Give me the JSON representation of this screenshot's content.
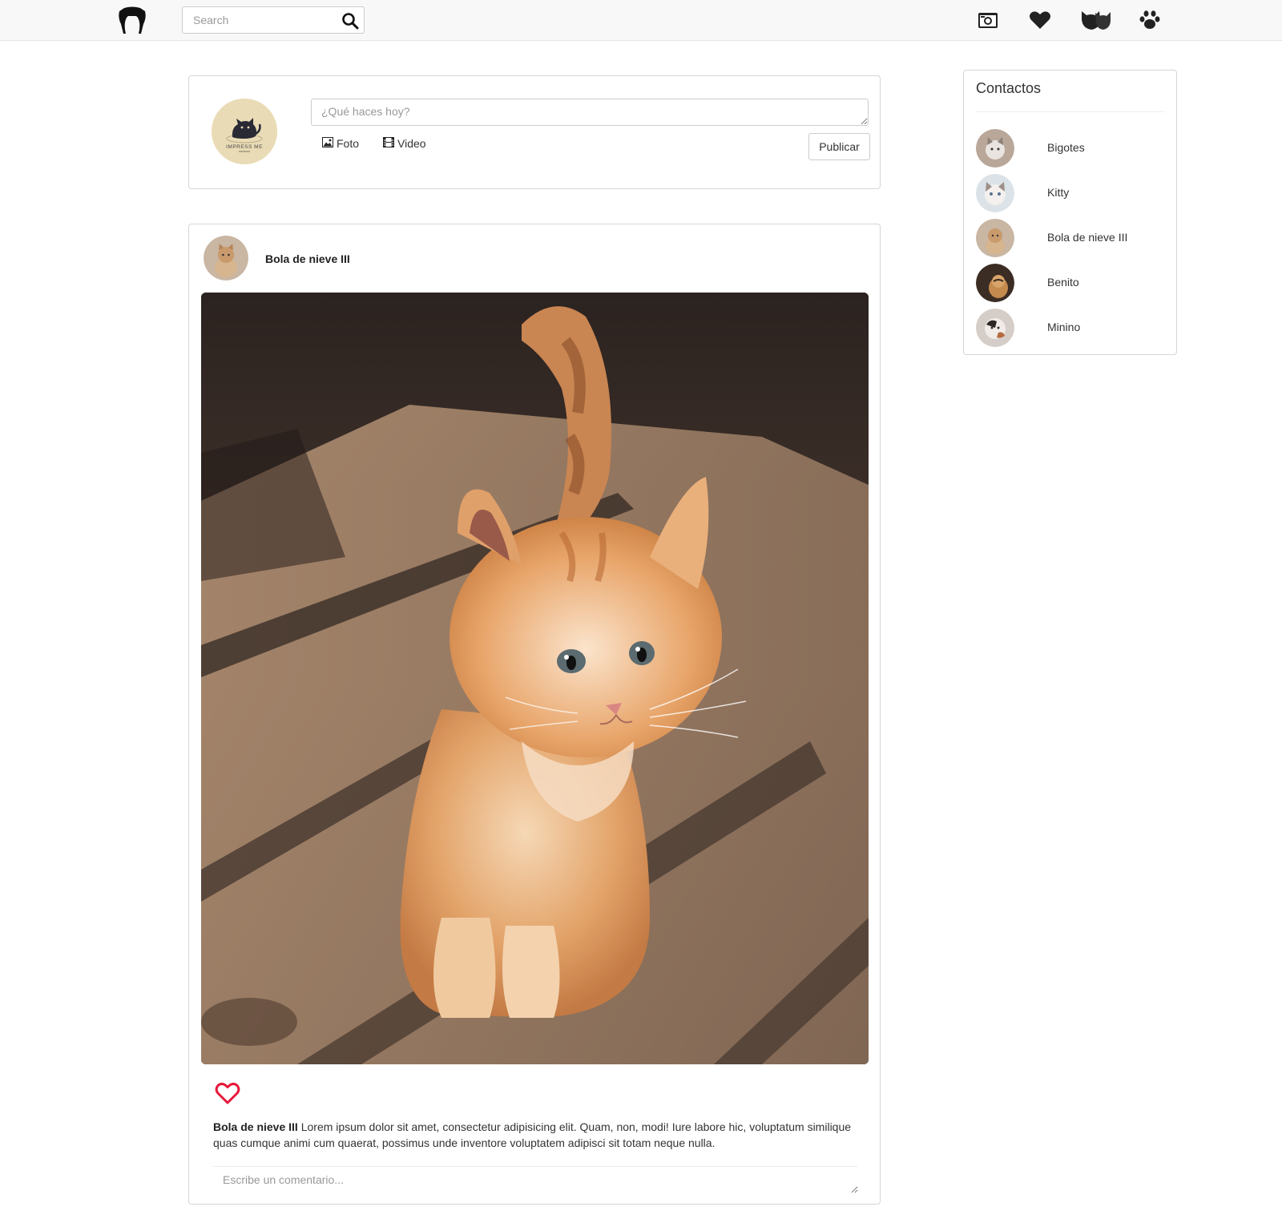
{
  "navbar": {
    "brand_icon": "cat-head-icon",
    "search": {
      "placeholder": "Search",
      "value": "",
      "button_icon": "search-icon"
    },
    "icons": [
      "camera-icon",
      "heart-icon",
      "cats-icon",
      "paw-icon"
    ]
  },
  "composer": {
    "avatar_icon": "impress-me-cat-logo",
    "avatar_logo_text": "IMPRESS ME",
    "placeholder": "¿Qué haces hoy?",
    "photo_label": "Foto",
    "video_label": "Video",
    "publish_label": "Publicar"
  },
  "post": {
    "author": "Bola de nieve III",
    "image": "orange-kitten-photo",
    "like_color": "#e8173a",
    "caption_author": "Bola de nieve III",
    "caption_text": " Lorem ipsum dolor sit amet, consectetur adipisicing elit. Quam, non, modi! Iure labore hic, voluptatum similique quas cumque animi cum quaerat, possimus unde inventore voluptatem adipisci sit totam neque nulla.",
    "comment_placeholder": "Escribe un comentario..."
  },
  "contacts": {
    "title": "Contactos",
    "items": [
      {
        "name": "Bigotes"
      },
      {
        "name": "Kitty"
      },
      {
        "name": "Bola de nieve III"
      },
      {
        "name": "Benito"
      },
      {
        "name": "Minino"
      }
    ]
  }
}
